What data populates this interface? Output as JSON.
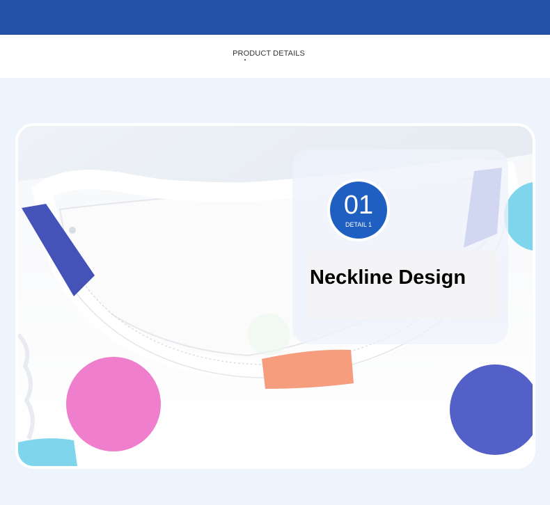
{
  "header": {
    "title": "PRODUCT DETAILS"
  },
  "detail": {
    "number": "01",
    "label": "DETAIL 1",
    "title": "Neckline Design"
  },
  "colors": {
    "top_bar": "#2450a8",
    "badge": "#1e5fc1",
    "page_background": "#eef4fc"
  },
  "photo": {
    "subject": "white polka-dot shirt neckline close-up"
  }
}
